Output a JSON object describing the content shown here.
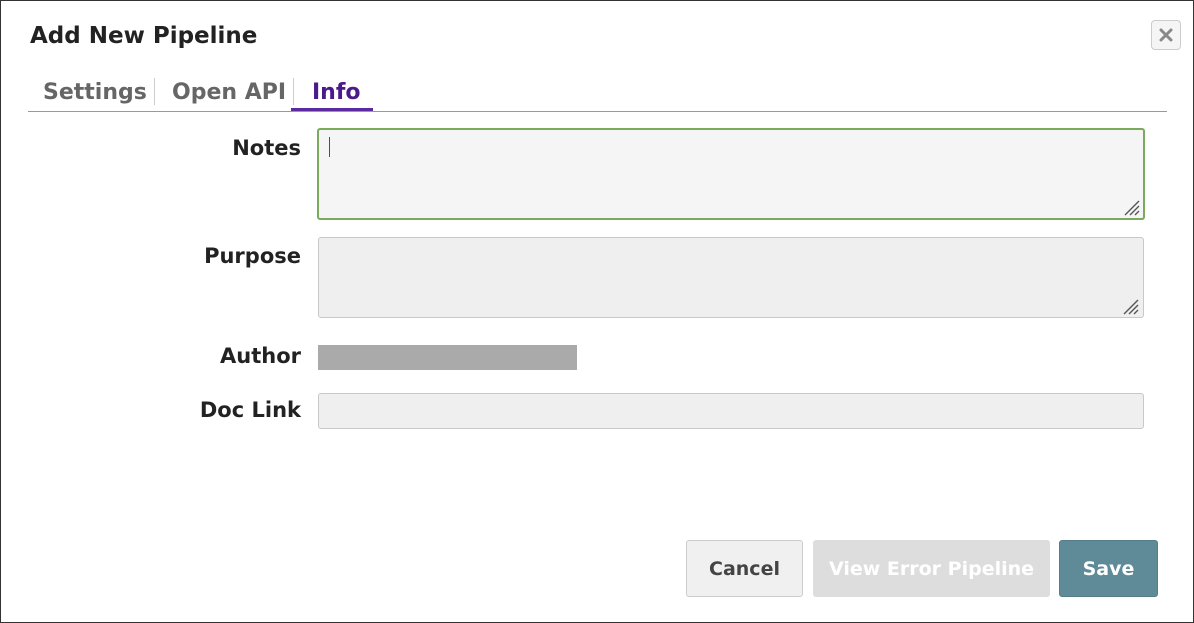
{
  "dialog": {
    "title": "Add New Pipeline",
    "close_icon": "close-icon"
  },
  "tabs": [
    {
      "label": "Settings",
      "active": false
    },
    {
      "label": "Open API",
      "active": false
    },
    {
      "label": "Info",
      "active": true
    }
  ],
  "form": {
    "notes": {
      "label": "Notes",
      "value": ""
    },
    "purpose": {
      "label": "Purpose",
      "value": ""
    },
    "author": {
      "label": "Author",
      "value": ""
    },
    "doc_link": {
      "label": "Doc Link",
      "value": ""
    }
  },
  "footer": {
    "cancel_label": "Cancel",
    "view_error_label": "View Error Pipeline",
    "save_label": "Save"
  },
  "colors": {
    "active_tab": "#4b1a8a",
    "focus_border": "#7aaa5c",
    "save_button": "#5f8a98"
  }
}
